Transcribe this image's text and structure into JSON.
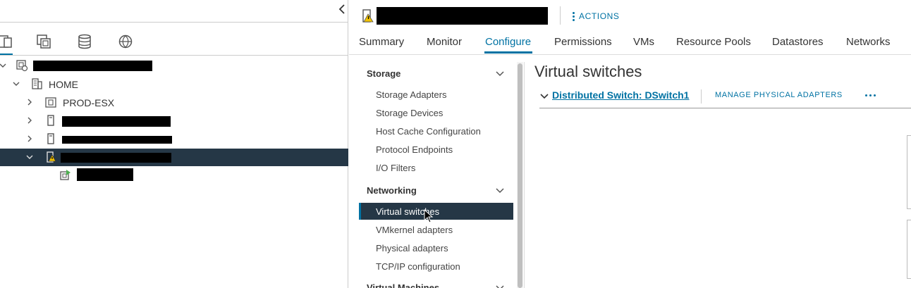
{
  "navigator": {
    "tabs": [
      {
        "name": "hosts-and-clusters",
        "icon": "hosts-clusters-icon"
      },
      {
        "name": "vms-and-templates",
        "icon": "vms-templates-icon"
      },
      {
        "name": "storage",
        "icon": "storage-icon"
      },
      {
        "name": "networking",
        "icon": "network-icon"
      }
    ],
    "tree": {
      "datacenter_label": "HOME",
      "cluster_label": "PROD-ESX"
    }
  },
  "header": {
    "actions_label": "ACTIONS"
  },
  "tabs": [
    {
      "label": "Summary"
    },
    {
      "label": "Monitor"
    },
    {
      "label": "Configure"
    },
    {
      "label": "Permissions"
    },
    {
      "label": "VMs"
    },
    {
      "label": "Resource Pools"
    },
    {
      "label": "Datastores"
    },
    {
      "label": "Networks"
    }
  ],
  "active_tab": "Configure",
  "config_nav": {
    "storage": {
      "title": "Storage",
      "items": [
        "Storage Adapters",
        "Storage Devices",
        "Host Cache Configuration",
        "Protocol Endpoints",
        "I/O Filters"
      ]
    },
    "networking": {
      "title": "Networking",
      "items": [
        "Virtual switches",
        "VMkernel adapters",
        "Physical adapters",
        "TCP/IP configuration"
      ]
    },
    "virtual_machines": {
      "title": "Virtual Machines"
    },
    "active_item": "Virtual switches"
  },
  "content": {
    "title": "Virtual switches",
    "switch_name": "Distributed Switch: DSwitch1",
    "manage_label": "MANAGE PHYSICAL ADAPTERS"
  },
  "colors": {
    "accent": "#0072a3",
    "selected_bg": "#253746",
    "warning": "#f3c300"
  }
}
